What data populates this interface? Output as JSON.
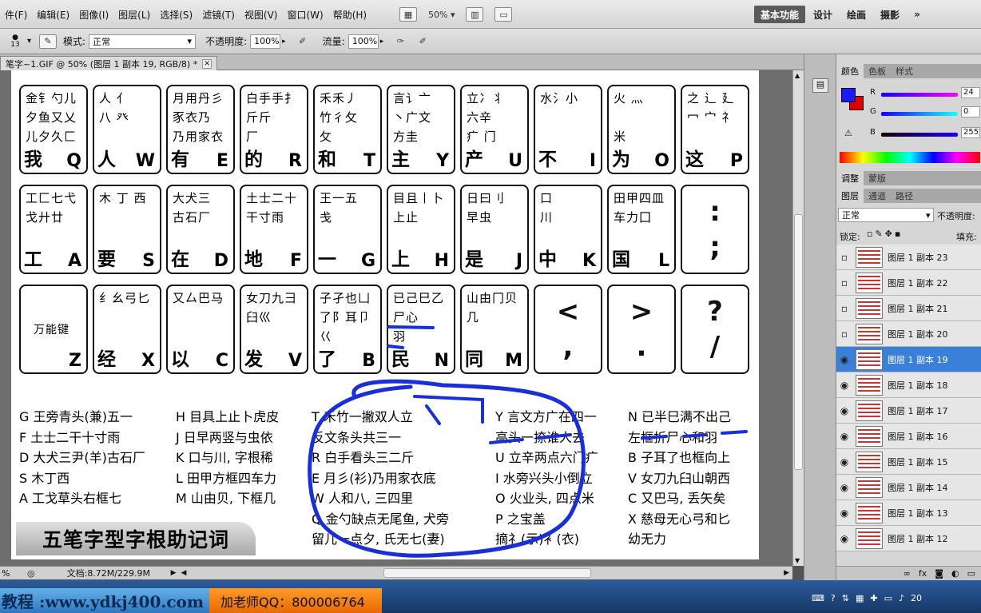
{
  "menubar": {
    "items": [
      "件(F)",
      "编辑(E)",
      "图像(I)",
      "图层(L)",
      "选择(S)",
      "滤镜(T)",
      "视图(V)",
      "窗口(W)",
      "帮助(H)"
    ],
    "zoom": "50%",
    "workspaces": [
      "基本功能",
      "设计",
      "绘画",
      "摄影"
    ],
    "more": "»"
  },
  "options": {
    "brush_size": "13",
    "mode_label": "模式:",
    "mode_value": "正常",
    "opacity_label": "不透明度:",
    "opacity_value": "100%",
    "flow_label": "流量:",
    "flow_value": "100%"
  },
  "doc_tab": {
    "title": "笔字~1.GIF @ 50% (图层 1 副本 19, RGB/8) *",
    "close": "×"
  },
  "keyboard": {
    "row1": [
      {
        "r1": "金钅勺儿",
        "r2": "夕鱼又乂",
        "r3": "儿夕久匚",
        "big": "我",
        "letter": "Q"
      },
      {
        "r1": "人 亻",
        "r2": "八 癶",
        "r3": "",
        "big": "人",
        "letter": "W"
      },
      {
        "r1": "月用丹彡",
        "r2": "豕衣乃",
        "r3": "乃用家衣",
        "big": "有",
        "letter": "E"
      },
      {
        "r1": "白手手扌",
        "r2": "斤斤",
        "r3": "厂",
        "big": "的",
        "letter": "R"
      },
      {
        "r1": "禾禾丿",
        "r2": "竹彳攵",
        "r3": "攵",
        "big": "和",
        "letter": "T"
      },
      {
        "r1": "言讠亠",
        "r2": "丶广文",
        "r3": "方圭",
        "big": "主",
        "letter": "Y"
      },
      {
        "r1": "立冫丬",
        "r2": "六辛",
        "r3": "疒 门",
        "big": "产",
        "letter": "U"
      },
      {
        "r1": "水氵小",
        "r2": "",
        "r3": "",
        "big": "不",
        "letter": "I"
      },
      {
        "r1": "火 灬",
        "r2": "",
        "r3": "米",
        "big": "为",
        "letter": "O"
      },
      {
        "r1": "之 辶 廴",
        "r2": "冖 宀 礻",
        "r3": "",
        "big": "这",
        "letter": "P"
      }
    ],
    "row2": [
      {
        "r1": "工匚七弋",
        "r2": "戈廾廿",
        "r3": "",
        "big": "工",
        "letter": "A"
      },
      {
        "r1": "木 丁 西",
        "r2": "",
        "r3": "",
        "big": "要",
        "letter": "S"
      },
      {
        "r1": "大犬三",
        "r2": "古石厂",
        "r3": "",
        "big": "在",
        "letter": "D"
      },
      {
        "r1": "土士二十",
        "r2": "干寸雨",
        "r3": "",
        "big": "地",
        "letter": "F"
      },
      {
        "r1": "王一五",
        "r2": "戋",
        "r3": "",
        "big": "一",
        "letter": "G"
      },
      {
        "r1": "目且丨卜",
        "r2": "上止",
        "r3": "",
        "big": "上",
        "letter": "H"
      },
      {
        "r1": "日曰刂",
        "r2": "早虫",
        "r3": "",
        "big": "是",
        "letter": "J"
      },
      {
        "r1": "口",
        "r2": "川",
        "r3": "",
        "big": "中",
        "letter": "K"
      },
      {
        "r1": "田甲四皿",
        "r2": "车力囗",
        "r3": "",
        "big": "国",
        "letter": "L"
      },
      {
        "mid": ":\n;"
      }
    ],
    "row3": [
      {
        "label": "万能键",
        "letter": "Z"
      },
      {
        "r1": "纟幺弓匕",
        "r2": "",
        "r3": "",
        "big": "经",
        "letter": "X"
      },
      {
        "r1": "又厶巴马",
        "r2": "",
        "r3": "",
        "big": "以",
        "letter": "C"
      },
      {
        "r1": "女刀九彐",
        "r2": "臼巛",
        "r3": "",
        "big": "发",
        "letter": "V"
      },
      {
        "r1": "子孑也凵",
        "r2": "了阝耳卩",
        "r3": "巜",
        "big": "了",
        "letter": "B"
      },
      {
        "r1": "已己巳乙",
        "r2": "尸心",
        "r3": "羽",
        "big": "民",
        "letter": "N"
      },
      {
        "r1": "山由冂贝",
        "r2": "几",
        "r3": "",
        "big": "同",
        "letter": "M"
      },
      {
        "mid": "<\n,"
      },
      {
        "mid": ">\n."
      },
      {
        "mid": "?\n/"
      }
    ]
  },
  "mnemonics": {
    "col1": [
      "G 王旁青头(兼)五一",
      "F 土士二干十寸雨",
      "D 大犬三尹(羊)古石厂",
      "S 木丁西",
      "A 工戈草头右框七"
    ],
    "col2": [
      "H 目具上止卜虎皮",
      "J 日早两竖与虫依",
      "K 口与川, 字根稀",
      "L 田甲方框四车力",
      "M 山由贝, 下框几"
    ],
    "col3": [
      "T 禾竹一撇双人立",
      "  反文条头共三一",
      "R 白手看头三二斤",
      "E 月彡(衫)乃用家衣底",
      "W 人和八, 三四里",
      "Q 金勺缺点无尾鱼, 犬旁",
      "  留儿一点夕, 氏无七(妻)"
    ],
    "col4": [
      "Y 言文方广在四一",
      "  高头一捺谁人去",
      "U 立辛两点六门疒",
      "I 水旁兴头小倒立",
      "O 火业头, 四点米",
      "P 之宝盖",
      "  摘礻(示)衤(衣)"
    ],
    "col5": [
      "N 已半巳满不出己",
      "  左框折尸心和羽",
      "B 子耳了也框向上",
      "V 女刀九臼山朝西",
      "C 又巴马, 丢矢矣",
      "X 慈母无心弓和匕",
      "  幼无力"
    ],
    "title": "五笔字型字根助记词"
  },
  "status": {
    "zoom": "%",
    "doc": "文档:8.72M/229.9M"
  },
  "panel": {
    "tabs1": [
      "颜色",
      "色板",
      "样式"
    ],
    "r_label": "R",
    "r_value": "24",
    "g_label": "G",
    "g_value": "0",
    "b_label": "B",
    "b_value": "255",
    "tabs2": [
      "调整",
      "蒙版"
    ],
    "tabs3": [
      "图层",
      "通道",
      "路径"
    ],
    "blend": "正常",
    "opacity_label": "不透明度:",
    "lock_label": "锁定:",
    "fill_label": "填充:",
    "layers": [
      {
        "name": "图层 1 副本 23",
        "visible": false,
        "selected": false
      },
      {
        "name": "图层 1 副本 22",
        "visible": false,
        "selected": false
      },
      {
        "name": "图层 1 副本 21",
        "visible": false,
        "selected": false
      },
      {
        "name": "图层 1 副本 20",
        "visible": false,
        "selected": false
      },
      {
        "name": "图层 1 副本 19",
        "visible": true,
        "selected": true
      },
      {
        "name": "图层 1 副本 18",
        "visible": true,
        "selected": false
      },
      {
        "name": "图层 1 副本 17",
        "visible": true,
        "selected": false
      },
      {
        "name": "图层 1 副本 16",
        "visible": true,
        "selected": false
      },
      {
        "name": "图层 1 副本 15",
        "visible": true,
        "selected": false
      },
      {
        "name": "图层 1 副本 14",
        "visible": true,
        "selected": false
      },
      {
        "name": "图层 1 副本 13",
        "visible": true,
        "selected": false
      },
      {
        "name": "图层 1 副本 12",
        "visible": true,
        "selected": false
      }
    ]
  },
  "taskbar": {
    "banner_left": "教程 :www.ydkj400.com",
    "banner_right": "加老师QQ：800006764",
    "clock": "20"
  },
  "colors": {
    "annotation_blue": "#1a2fd6",
    "fg": "#1a1aff",
    "bg": "#e00000",
    "selection": "#3a80d8"
  }
}
